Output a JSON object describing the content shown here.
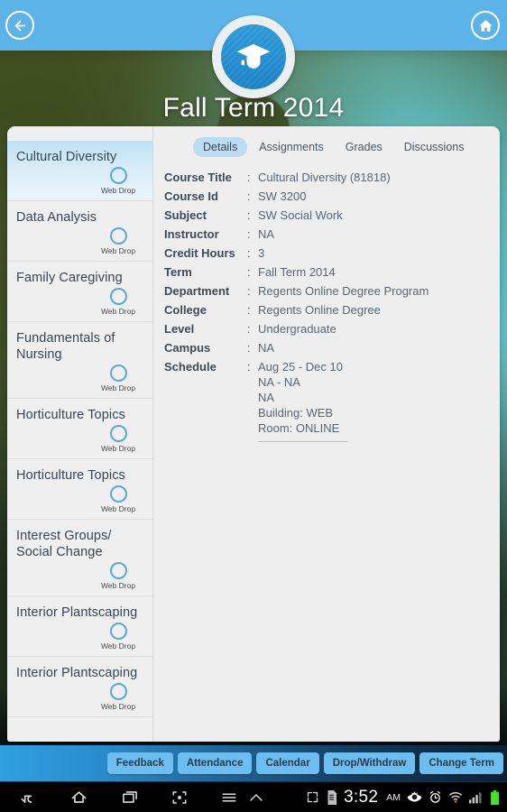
{
  "header": {
    "back_icon": "back-arrow-circle-icon",
    "home_icon": "home-circle-icon",
    "logo_icon": "graduation-cap-icon",
    "term_title": "Fall Term 2014"
  },
  "courses": [
    {
      "name": "Cultural Diversity",
      "badge": "Web Drop",
      "selected": true
    },
    {
      "name": "Data Analysis",
      "badge": "Web Drop",
      "selected": false
    },
    {
      "name": "Family Caregiving",
      "badge": "Web Drop",
      "selected": false
    },
    {
      "name": "Fundamentals of Nursing",
      "badge": "Web Drop",
      "selected": false
    },
    {
      "name": "Horticulture Topics",
      "badge": "Web Drop",
      "selected": false
    },
    {
      "name": "Horticulture Topics",
      "badge": "Web Drop",
      "selected": false
    },
    {
      "name": "Interest Groups/ Social Change",
      "badge": "Web Drop",
      "selected": false
    },
    {
      "name": "Interior Plantscaping",
      "badge": "Web Drop",
      "selected": false
    },
    {
      "name": "Interior Plantscaping",
      "badge": "Web Drop",
      "selected": false
    }
  ],
  "tabs": [
    {
      "label": "Details",
      "active": true
    },
    {
      "label": "Assignments",
      "active": false
    },
    {
      "label": "Grades",
      "active": false
    },
    {
      "label": "Discussions",
      "active": false
    }
  ],
  "details": [
    {
      "label": "Course Title",
      "value": "Cultural Diversity (81818)"
    },
    {
      "label": "Course Id",
      "value": "SW 3200"
    },
    {
      "label": "Subject",
      "value": "SW Social Work"
    },
    {
      "label": "Instructor",
      "value": "NA"
    },
    {
      "label": "Credit Hours",
      "value": "3"
    },
    {
      "label": "Term",
      "value": "Fall Term 2014"
    },
    {
      "label": "Department",
      "value": "Regents Online Degree Program"
    },
    {
      "label": "College",
      "value": "Regents Online Degree"
    },
    {
      "label": "Level",
      "value": "Undergraduate"
    },
    {
      "label": "Campus",
      "value": "NA"
    }
  ],
  "schedule": {
    "label": "Schedule",
    "lines": [
      "Aug 25 - Dec 10",
      "NA - NA",
      "NA",
      "Building: WEB",
      "Room: ONLINE"
    ]
  },
  "actions": [
    {
      "label": "Feedback"
    },
    {
      "label": "Attendance"
    },
    {
      "label": "Calendar"
    },
    {
      "label": "Drop/Withdraw"
    },
    {
      "label": "Change Term"
    }
  ],
  "navbar": {
    "back_icon": "back-icon",
    "home_icon": "home-icon",
    "recents_icon": "recent-apps-icon",
    "screenshot_icon": "screenshot-icon",
    "menu_icon": "menu-icon",
    "chevron_up_icon": "chevron-up-icon",
    "fullscreen_icon": "fullscreen-icon",
    "sdcard_icon": "sd-card-icon",
    "time": "3:52",
    "meridiem": "AM",
    "eye_icon": "eye-icon",
    "alarm_icon": "alarm-clock-icon",
    "wifi_icon": "wifi-icon",
    "signal_icon": "cell-signal-icon",
    "battery_icon": "battery-icon"
  },
  "colors": {
    "topbar_blue": "#5cb3e8",
    "accent_blue": "#2e9bd9",
    "selected_item": "#bfe2f5",
    "tab_active": "#bcdcf2",
    "action_button": "#6cbdf0",
    "battery_green": "#49e02a"
  }
}
